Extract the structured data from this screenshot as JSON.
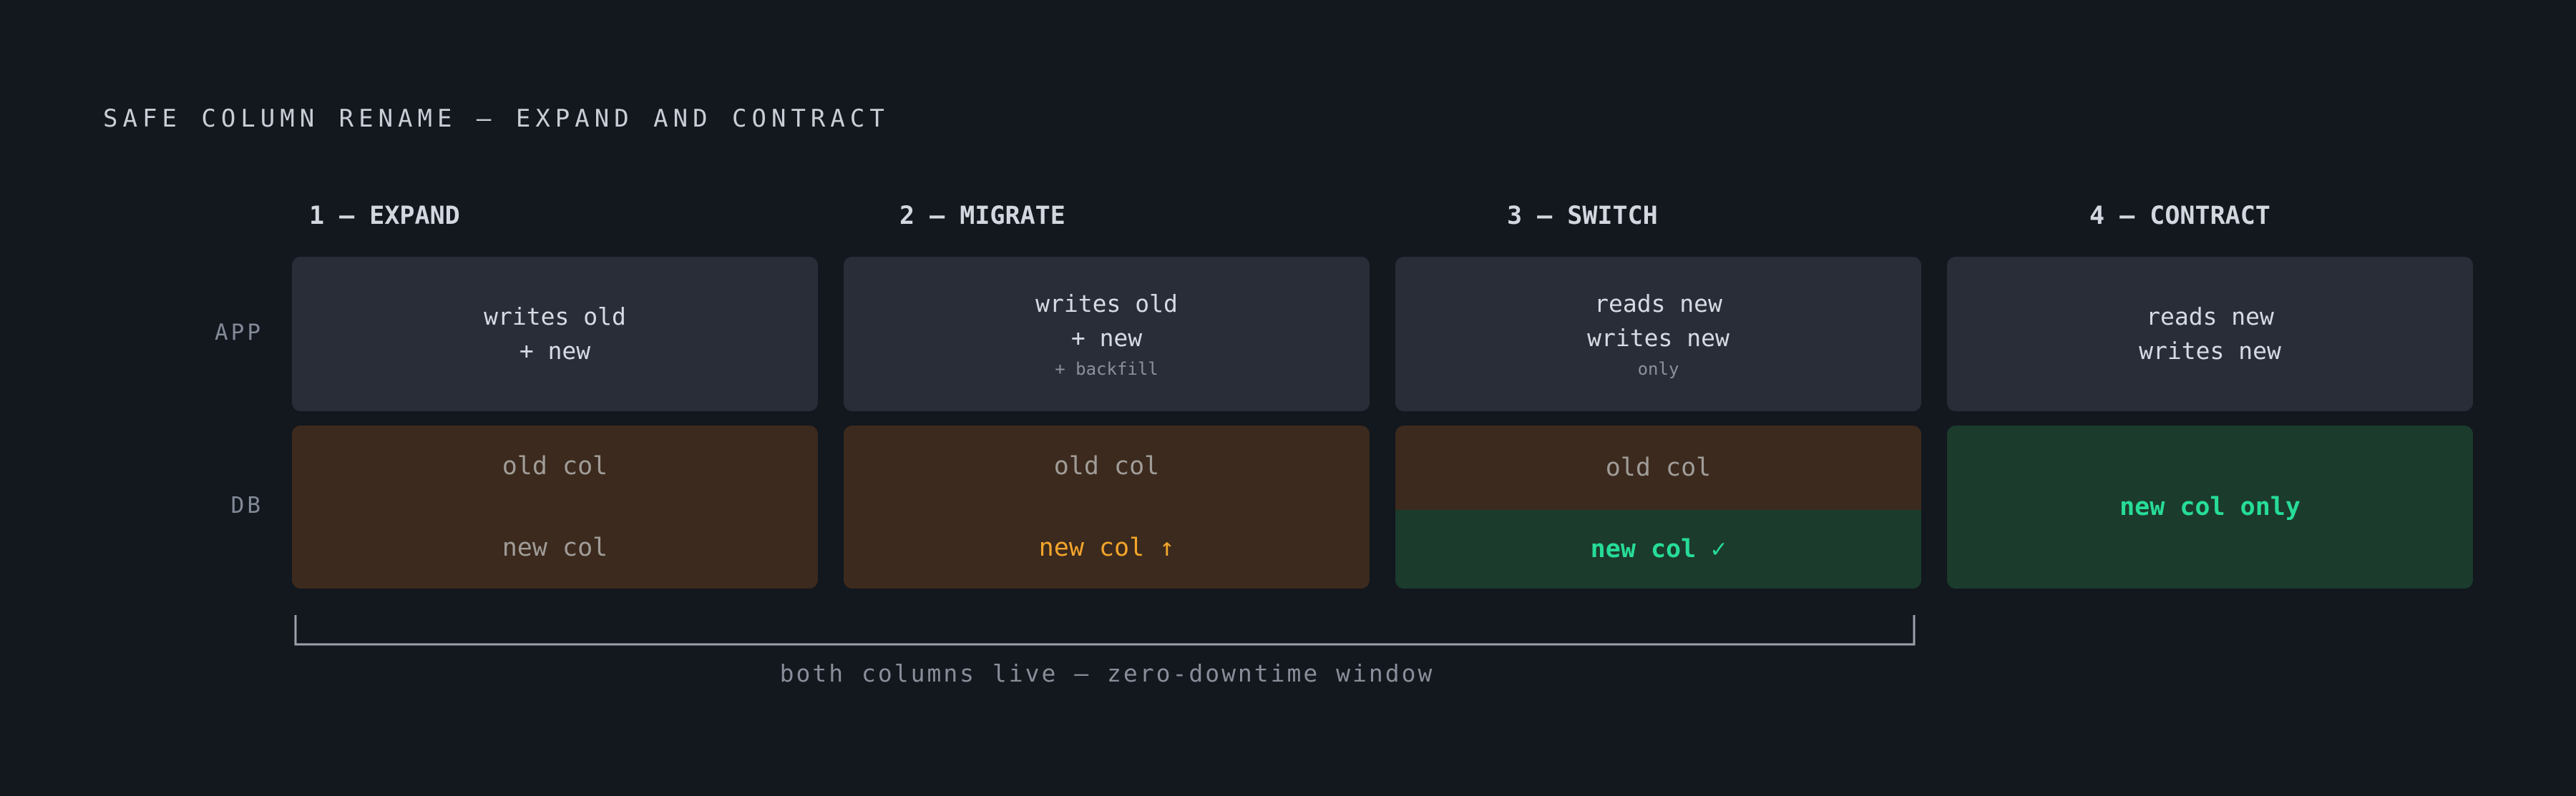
{
  "title": "SAFE COLUMN RENAME — EXPAND AND CONTRACT",
  "row_labels": {
    "app": "APP",
    "db": "DB"
  },
  "stages": [
    {
      "heading": "1 — EXPAND",
      "app": {
        "lines": [
          "writes old",
          "+ new"
        ],
        "note": ""
      },
      "db": {
        "top": "old col",
        "bottom": "new col"
      }
    },
    {
      "heading": "2 — MIGRATE",
      "app": {
        "lines": [
          "writes old",
          "+ new"
        ],
        "note": "+ backfill"
      },
      "db": {
        "top": "old col",
        "bottom": "new col ↑"
      }
    },
    {
      "heading": "3 — SWITCH",
      "app": {
        "lines": [
          "reads new",
          "writes new"
        ],
        "note": "only"
      },
      "db": {
        "top": "old col",
        "bottom": "new col ✓"
      }
    },
    {
      "heading": "4 — CONTRACT",
      "app": {
        "lines": [
          "reads new",
          "writes new"
        ],
        "note": ""
      },
      "db": {
        "only": "new col only"
      }
    }
  ],
  "window_caption": "both columns live — zero-downtime window",
  "colors": {
    "background": "#13171e",
    "app_box": "#292d38",
    "db_box": "#3b2a1d",
    "db_new_box": "#1b3b2d",
    "accent_orange": "#f3a52b",
    "accent_green": "#27dc97"
  }
}
